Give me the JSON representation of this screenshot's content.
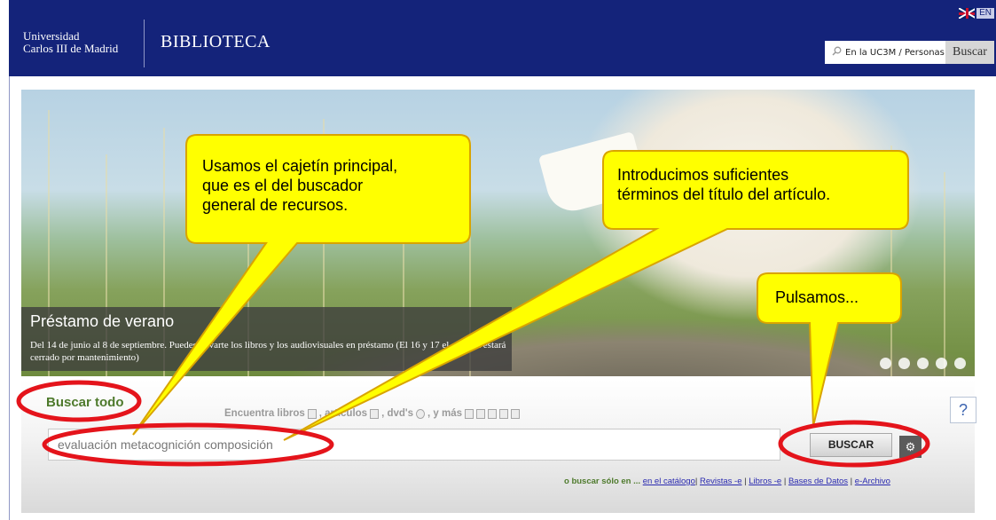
{
  "header": {
    "university_line1": "Universidad",
    "university_line2": "Carlos III de Madrid",
    "title": "BIBLIOTECA",
    "language_label": "EN",
    "search_placeholder": "En la UC3M / Personas",
    "search_button": "Buscar",
    "icons": {
      "flag": "uk-flag-icon",
      "search": "search-icon"
    }
  },
  "hero": {
    "caption_title": "Préstamo de verano",
    "caption_text": "Del 14 de junio al 8 de septiembre. Puedes llevarte los libros y los audiovisuales en préstamo (El 16 y 17 el sistema estará cerrado por mantenimiento)",
    "slide_count": 5
  },
  "search": {
    "heading": "Buscar todo",
    "encuentra_prefix": "Encuentra libros",
    "encuentra_articulos": ", artículos",
    "encuentra_dvds": ", dvd's",
    "encuentra_mas": ", y más",
    "help_label": "?",
    "query_value": "evaluación metacognición composición",
    "button_label": "BUSCAR",
    "settings_icon": "gear-icon",
    "only_in_label": "o buscar sólo en ...",
    "only_in_links": [
      "en el catálogo",
      "Revistas -e",
      "Libros -e",
      "Bases de Datos",
      "e-Archivo"
    ]
  },
  "annotations": {
    "callout_left": [
      "Usamos el cajetín principal,",
      "que es el del buscador",
      "general de recursos."
    ],
    "callout_middle": [
      "Introducimos suficientes",
      "términos del título del artículo."
    ],
    "callout_right": "Pulsamos...",
    "callout_fill": "#ffff00",
    "circle_color": "#e4141b"
  }
}
